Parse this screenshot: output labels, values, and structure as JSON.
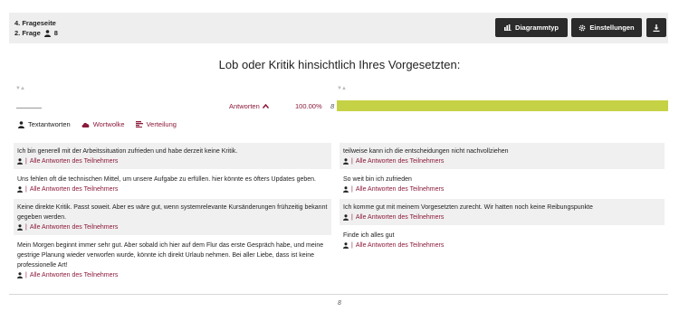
{
  "header": {
    "page_label": "4. Frageseite",
    "question_label": "2. Frage",
    "respondents": "8",
    "buttons": {
      "chart_type": "Diagrammtyp",
      "settings": "Einstellungen"
    }
  },
  "question_title": "Lob oder Kritik hinsichtlich Ihres Vorgesetzten:",
  "result_row": {
    "antworten": "Antworten",
    "percent": "100.00%",
    "count": "8",
    "fill": 1.0
  },
  "view_tabs": {
    "text": "Textantworten",
    "cloud": "Wortwolke",
    "dist": "Verteilung"
  },
  "link_text": "Alle Antworten des Teilnehmers",
  "link_sep": "|",
  "answers_left": [
    {
      "text": "Ich bin generell mit der Arbeitssituation zufrieden und habe derzeit keine Kritik."
    },
    {
      "text": "Uns fehlen oft die technischen Mittel, um unsere Aufgabe zu erfüllen. hier könnte es öfters Updates geben."
    },
    {
      "text": "Keine direkte Kritik. Passt soweit. Aber es wäre gut, wenn systemrelevante Kursänderungen frühzeitig bekannt gegeben werden."
    },
    {
      "text": "Mein Morgen beginnt immer sehr gut. Aber sobald ich hier auf dem Flur das erste Gespräch habe, und meine gestrige Planung wieder verworfen wurde, könnte ich direkt Urlaub nehmen. Bei aller Liebe, dass ist keine professionelle Art!"
    }
  ],
  "answers_right": [
    {
      "text": "teilweise kann ich die entscheidungen nicht nachvollziehen"
    },
    {
      "text": "So weit bin ich zufrieden"
    },
    {
      "text": "Ich komme gut mit meinem Vorgesetzten zurecht. Wir hatten noch keine Reibungspunkte"
    },
    {
      "text": "Finde ich alles gut"
    }
  ],
  "footer_count": "8",
  "colors": {
    "accent": "#8b1a3a",
    "bar": "#c6d245",
    "button": "#2b2b2b"
  }
}
